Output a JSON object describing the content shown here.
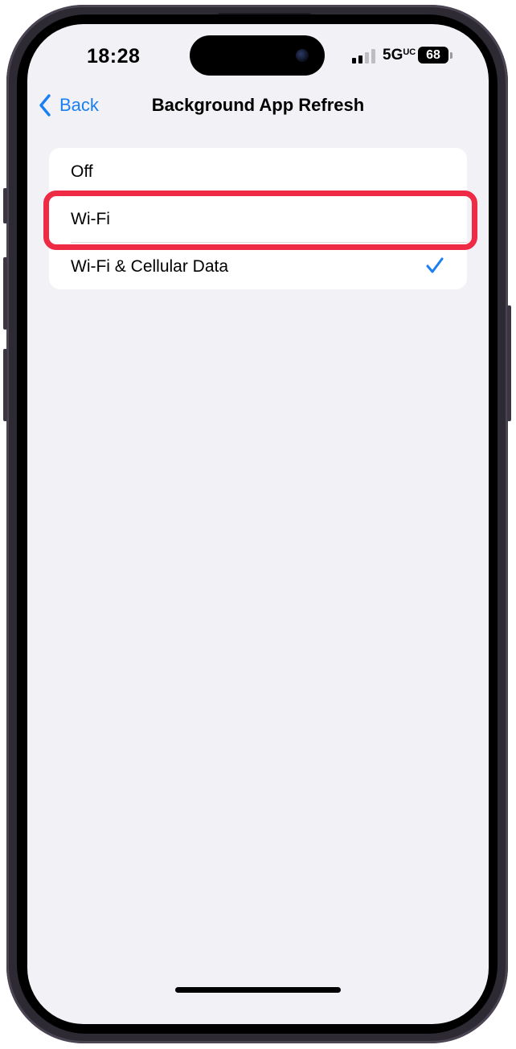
{
  "status_bar": {
    "time": "18:28",
    "network": "5G",
    "network_suffix": "UC",
    "battery": "68",
    "signal_bars_active": 2,
    "signal_bars_total": 4
  },
  "nav": {
    "back_label": "Back",
    "title": "Background App Refresh"
  },
  "options": [
    {
      "label": "Off",
      "selected": false
    },
    {
      "label": "Wi-Fi",
      "selected": false,
      "highlighted": true
    },
    {
      "label": "Wi-Fi & Cellular Data",
      "selected": true
    }
  ],
  "colors": {
    "accent": "#1a7ff2",
    "highlight": "#ee2a45",
    "background": "#f2f1f6",
    "cell": "#ffffff"
  },
  "icons": {
    "back": "chevron-left-icon",
    "check": "checkmark-icon"
  }
}
